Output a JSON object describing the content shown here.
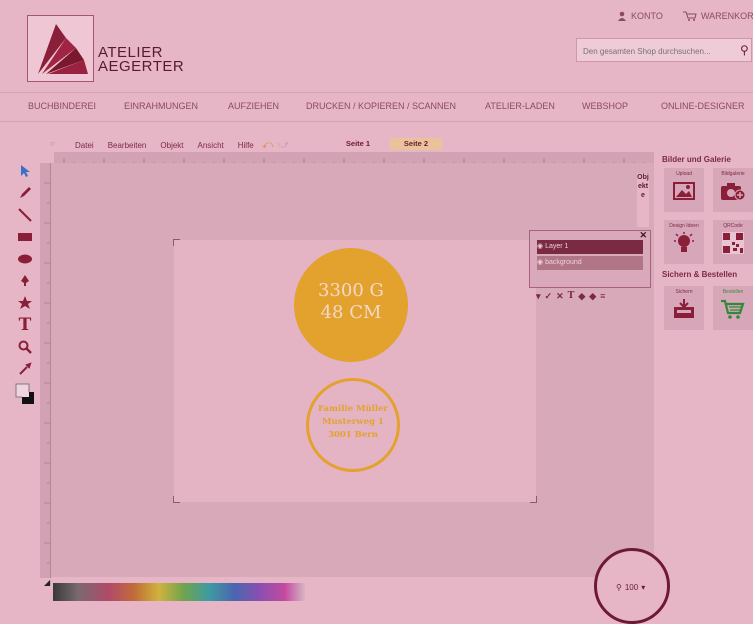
{
  "header": {
    "brand_line1": "ATELIER",
    "brand_line2": "AEGERTER",
    "account_label": "KONTO",
    "cart_label": "WARENKORB",
    "search_placeholder": "Den gesamten Shop durchsuchen..."
  },
  "nav": [
    "BUCHBINDEREI",
    "EINRAHMUNGEN",
    "AUFZIEHEN",
    "DRUCKEN / KOPIEREN / SCANNEN",
    "ATELIER-LADEN",
    "WEBSHOP",
    "ONLINE-DESIGNER"
  ],
  "editor": {
    "menu": [
      "Datei",
      "Bearbeiten",
      "Objekt",
      "Ansicht",
      "Hilfe"
    ],
    "pages": [
      "Seite 1",
      "Seite 2"
    ],
    "active_page": "Seite 2",
    "objects_tab": "Objekte",
    "zoom": "100"
  },
  "design": {
    "circle_line1": "3300 G",
    "circle_line2": "48 CM",
    "address_line1": "Familie Müller",
    "address_line2": "Musterweg 1",
    "address_line3": "3001 Bern"
  },
  "layers": {
    "items": [
      "Layer 1",
      "background"
    ]
  },
  "sidebar": {
    "section1_title": "Bilder und Galerie",
    "upload": "Upload",
    "gallery": "Bildgalerie",
    "design_ideas": "Design Ideen",
    "qrcode": "QRCode",
    "section2_title": "Sichern & Bestellen",
    "save": "Sichern",
    "order": "Bestellen"
  },
  "colors": {
    "accent": "#6e1a33",
    "gold": "#e3a22e",
    "background": "#e6b6c7"
  }
}
